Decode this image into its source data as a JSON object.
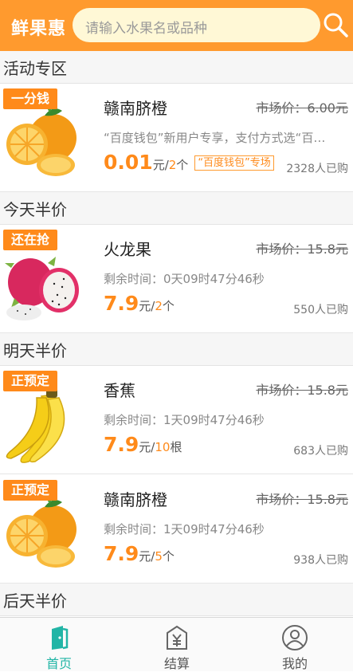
{
  "header": {
    "logo": "鲜果惠",
    "search_placeholder": "请输入水果名或品种"
  },
  "sections": [
    {
      "title": "活动专区",
      "items": [
        {
          "badge": "一分钱",
          "name": "赣南脐橙",
          "old_price": "市场价：6.00元",
          "desc": "“百度钱包”新用户专享，支付方式选“百…",
          "price": "0.01",
          "unit_prefix": "元/",
          "unit_qty": "2",
          "unit_suffix": "个",
          "tag": "“百度钱包”专场",
          "sold": "2328人已购",
          "image": "orange"
        }
      ]
    },
    {
      "title": "今天半价",
      "items": [
        {
          "badge": "还在抢",
          "name": "火龙果",
          "old_price": "市场价：15.8元",
          "desc": "剩余时间：0天09时47分46秒",
          "price": "7.9",
          "unit_prefix": "元/",
          "unit_qty": "2",
          "unit_suffix": "个",
          "sold": "550人已购",
          "image": "dragonfruit"
        }
      ]
    },
    {
      "title": "明天半价",
      "items": [
        {
          "badge": "正预定",
          "name": "香蕉",
          "old_price": "市场价：15.8元",
          "desc": "剩余时间：1天09时47分46秒",
          "price": "7.9",
          "unit_prefix": "元/",
          "unit_qty": "10",
          "unit_suffix": "根",
          "sold": "683人已购",
          "image": "banana"
        },
        {
          "badge": "正预定",
          "name": "赣南脐橙",
          "old_price": "市场价：15.8元",
          "desc": "剩余时间：1天09时47分46秒",
          "price": "7.9",
          "unit_prefix": "元/",
          "unit_qty": "5",
          "unit_suffix": "个",
          "sold": "938人已购",
          "image": "orange"
        }
      ]
    },
    {
      "title": "后天半价",
      "items": []
    }
  ],
  "tabs": [
    {
      "label": "首页",
      "icon": "home-icon",
      "active": true
    },
    {
      "label": "结算",
      "icon": "checkout-yuan-icon",
      "active": false
    },
    {
      "label": "我的",
      "icon": "profile-icon",
      "active": false
    }
  ],
  "colors": {
    "brand": "#ff9a2e",
    "price": "#ff8a1a",
    "active_tab": "#22b5a6"
  }
}
